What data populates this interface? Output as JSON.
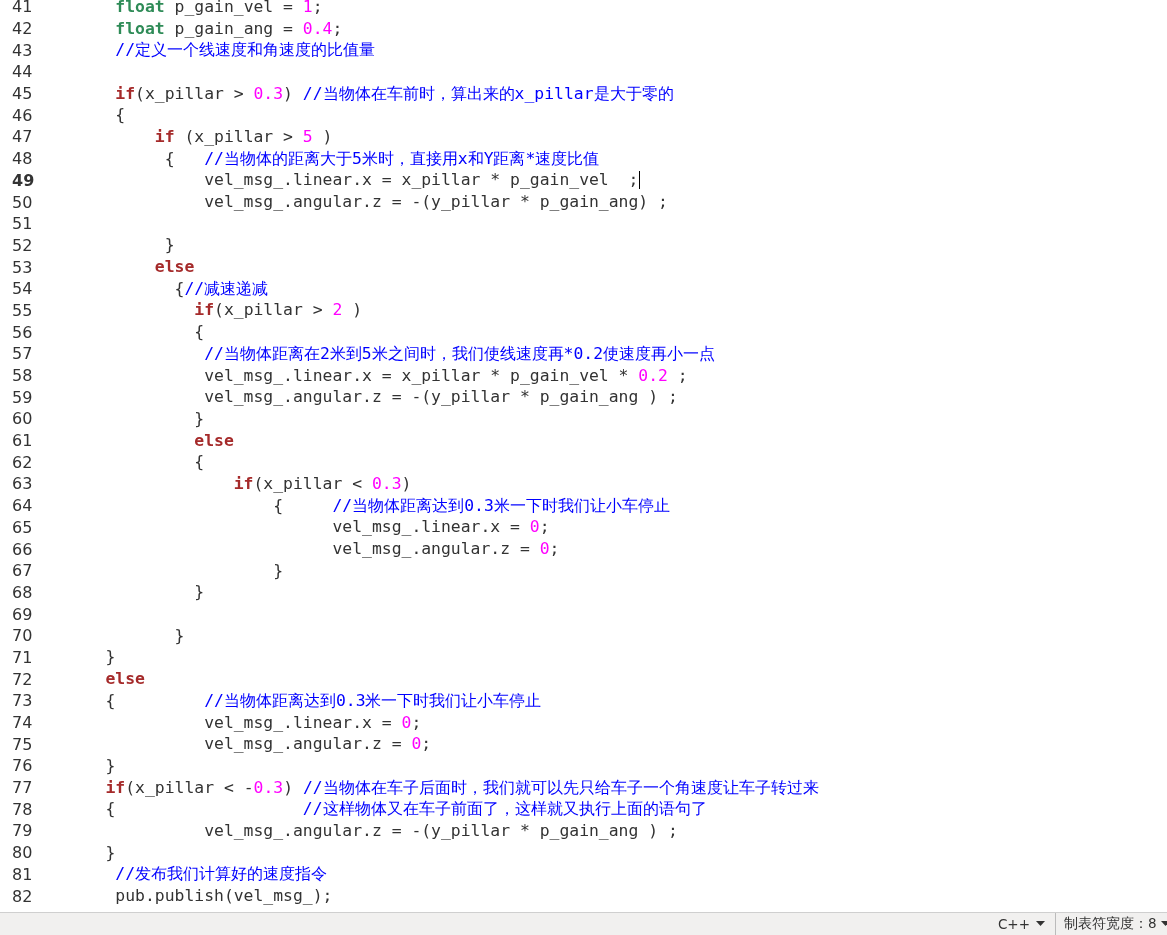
{
  "editor": {
    "lines": [
      {
        "n": "41",
        "current": false,
        "tokens": [
          {
            "kind": "type",
            "text": "     float"
          },
          {
            "kind": "plain",
            "text": " p_gain_vel = "
          },
          {
            "kind": "number",
            "text": "1"
          },
          {
            "kind": "plain",
            "text": ";"
          }
        ]
      },
      {
        "n": "42",
        "current": false,
        "tokens": [
          {
            "kind": "type",
            "text": "     float"
          },
          {
            "kind": "plain",
            "text": " p_gain_ang = "
          },
          {
            "kind": "number",
            "text": "0.4"
          },
          {
            "kind": "plain",
            "text": ";"
          }
        ]
      },
      {
        "n": "43",
        "current": false,
        "tokens": [
          {
            "kind": "comment",
            "text": "     //定义一个线速度和角速度的比值量"
          }
        ]
      },
      {
        "n": "44",
        "current": false
      },
      {
        "n": "45",
        "current": false,
        "tokens": [
          {
            "kind": "keyword",
            "text": "     if"
          },
          {
            "kind": "plain",
            "text": "(x_pillar > "
          },
          {
            "kind": "number",
            "text": "0.3"
          },
          {
            "kind": "plain",
            "text": ") "
          },
          {
            "kind": "comment",
            "text": "//当物体在车前时，算出来的x_pillar是大于零的"
          }
        ]
      },
      {
        "n": "46",
        "current": false,
        "tokens": [
          {
            "kind": "plain",
            "text": "     {"
          }
        ]
      },
      {
        "n": "47",
        "current": false,
        "tokens": [
          {
            "kind": "keyword",
            "text": "         if"
          },
          {
            "kind": "plain",
            "text": " (x_pillar > "
          },
          {
            "kind": "number",
            "text": "5"
          },
          {
            "kind": "plain",
            "text": " )"
          }
        ]
      },
      {
        "n": "48",
        "current": false,
        "tokens": [
          {
            "kind": "plain",
            "text": "          {   "
          },
          {
            "kind": "comment",
            "text": "//当物体的距离大于5米时，直接用x和Y距离*速度比值"
          }
        ]
      },
      {
        "n": "49",
        "current": true,
        "tokens": [
          {
            "kind": "plain",
            "text": "              vel_msg_.linear.x = x_pillar * p_gain_vel  ;"
          }
        ]
      },
      {
        "n": "50",
        "current": false,
        "tokens": [
          {
            "kind": "plain",
            "text": "              vel_msg_.angular.z = -(y_pillar * p_gain_ang) ;"
          }
        ]
      },
      {
        "n": "51",
        "current": false
      },
      {
        "n": "52",
        "current": false,
        "tokens": [
          {
            "kind": "plain",
            "text": "          }"
          }
        ]
      },
      {
        "n": "53",
        "current": false,
        "tokens": [
          {
            "kind": "keyword",
            "text": "         else"
          }
        ]
      },
      {
        "n": "54",
        "current": false,
        "tokens": [
          {
            "kind": "plain",
            "text": "           {"
          },
          {
            "kind": "comment",
            "text": "//减速递减"
          }
        ]
      },
      {
        "n": "55",
        "current": false,
        "tokens": [
          {
            "kind": "keyword",
            "text": "             if"
          },
          {
            "kind": "plain",
            "text": "(x_pillar > "
          },
          {
            "kind": "number",
            "text": "2"
          },
          {
            "kind": "plain",
            "text": " )"
          }
        ]
      },
      {
        "n": "56",
        "current": false,
        "tokens": [
          {
            "kind": "plain",
            "text": "             {"
          }
        ]
      },
      {
        "n": "57",
        "current": false,
        "tokens": [
          {
            "kind": "comment",
            "text": "              //当物体距离在2米到5米之间时，我们使线速度再*0.2使速度再小一点"
          }
        ]
      },
      {
        "n": "58",
        "current": false,
        "tokens": [
          {
            "kind": "plain",
            "text": "              vel_msg_.linear.x = x_pillar * p_gain_vel * "
          },
          {
            "kind": "number",
            "text": "0.2"
          },
          {
            "kind": "plain",
            "text": " ;"
          }
        ]
      },
      {
        "n": "59",
        "current": false,
        "tokens": [
          {
            "kind": "plain",
            "text": "              vel_msg_.angular.z = -(y_pillar * p_gain_ang ) ;"
          }
        ]
      },
      {
        "n": "60",
        "current": false,
        "tokens": [
          {
            "kind": "plain",
            "text": "             }"
          }
        ]
      },
      {
        "n": "61",
        "current": false,
        "tokens": [
          {
            "kind": "keyword",
            "text": "             else"
          }
        ]
      },
      {
        "n": "62",
        "current": false,
        "tokens": [
          {
            "kind": "plain",
            "text": "             {"
          }
        ]
      },
      {
        "n": "63",
        "current": false,
        "tokens": [
          {
            "kind": "keyword",
            "text": "                 if"
          },
          {
            "kind": "plain",
            "text": "(x_pillar < "
          },
          {
            "kind": "number",
            "text": "0.3"
          },
          {
            "kind": "plain",
            "text": ")"
          }
        ]
      },
      {
        "n": "64",
        "current": false,
        "tokens": [
          {
            "kind": "plain",
            "text": "                     {     "
          },
          {
            "kind": "comment",
            "text": "//当物体距离达到0.3米一下时我们让小车停止"
          }
        ]
      },
      {
        "n": "65",
        "current": false,
        "tokens": [
          {
            "kind": "plain",
            "text": "                           vel_msg_.linear.x = "
          },
          {
            "kind": "number",
            "text": "0"
          },
          {
            "kind": "plain",
            "text": ";"
          }
        ]
      },
      {
        "n": "66",
        "current": false,
        "tokens": [
          {
            "kind": "plain",
            "text": "                           vel_msg_.angular.z = "
          },
          {
            "kind": "number",
            "text": "0"
          },
          {
            "kind": "plain",
            "text": ";"
          }
        ]
      },
      {
        "n": "67",
        "current": false,
        "tokens": [
          {
            "kind": "plain",
            "text": "                     }"
          }
        ]
      },
      {
        "n": "68",
        "current": false,
        "tokens": [
          {
            "kind": "plain",
            "text": "             }"
          }
        ]
      },
      {
        "n": "69",
        "current": false
      },
      {
        "n": "70",
        "current": false,
        "tokens": [
          {
            "kind": "plain",
            "text": "           }"
          }
        ]
      },
      {
        "n": "71",
        "current": false,
        "tokens": [
          {
            "kind": "plain",
            "text": "    }"
          }
        ]
      },
      {
        "n": "72",
        "current": false,
        "tokens": [
          {
            "kind": "keyword",
            "text": "    else"
          }
        ]
      },
      {
        "n": "73",
        "current": false,
        "tokens": [
          {
            "kind": "plain",
            "text": "    {         "
          },
          {
            "kind": "comment",
            "text": "//当物体距离达到0.3米一下时我们让小车停止"
          }
        ]
      },
      {
        "n": "74",
        "current": false,
        "tokens": [
          {
            "kind": "plain",
            "text": "              vel_msg_.linear.x = "
          },
          {
            "kind": "number",
            "text": "0"
          },
          {
            "kind": "plain",
            "text": ";"
          }
        ]
      },
      {
        "n": "75",
        "current": false,
        "tokens": [
          {
            "kind": "plain",
            "text": "              vel_msg_.angular.z = "
          },
          {
            "kind": "number",
            "text": "0"
          },
          {
            "kind": "plain",
            "text": ";"
          }
        ]
      },
      {
        "n": "76",
        "current": false,
        "tokens": [
          {
            "kind": "plain",
            "text": "    }"
          }
        ]
      },
      {
        "n": "77",
        "current": false,
        "tokens": [
          {
            "kind": "keyword",
            "text": "    if"
          },
          {
            "kind": "plain",
            "text": "(x_pillar < -"
          },
          {
            "kind": "number",
            "text": "0.3"
          },
          {
            "kind": "plain",
            "text": ") "
          },
          {
            "kind": "comment",
            "text": "//当物体在车子后面时，我们就可以先只给车子一个角速度让车子转过来"
          }
        ]
      },
      {
        "n": "78",
        "current": false,
        "tokens": [
          {
            "kind": "plain",
            "text": "    {                   "
          },
          {
            "kind": "comment",
            "text": "//这样物体又在车子前面了，这样就又执行上面的语句了"
          }
        ]
      },
      {
        "n": "79",
        "current": false,
        "tokens": [
          {
            "kind": "plain",
            "text": "              vel_msg_.angular.z = -(y_pillar * p_gain_ang ) ;"
          }
        ]
      },
      {
        "n": "80",
        "current": false,
        "tokens": [
          {
            "kind": "plain",
            "text": "    }"
          }
        ]
      },
      {
        "n": "81",
        "current": false,
        "tokens": [
          {
            "kind": "comment",
            "text": "     //发布我们计算好的速度指令"
          }
        ]
      },
      {
        "n": "82",
        "current": false,
        "tokens": [
          {
            "kind": "plain",
            "text": "     pub.publish(vel_msg_);"
          }
        ]
      }
    ]
  },
  "status_bar": {
    "language": "C++",
    "tab_width": "制表符宽度：8"
  }
}
